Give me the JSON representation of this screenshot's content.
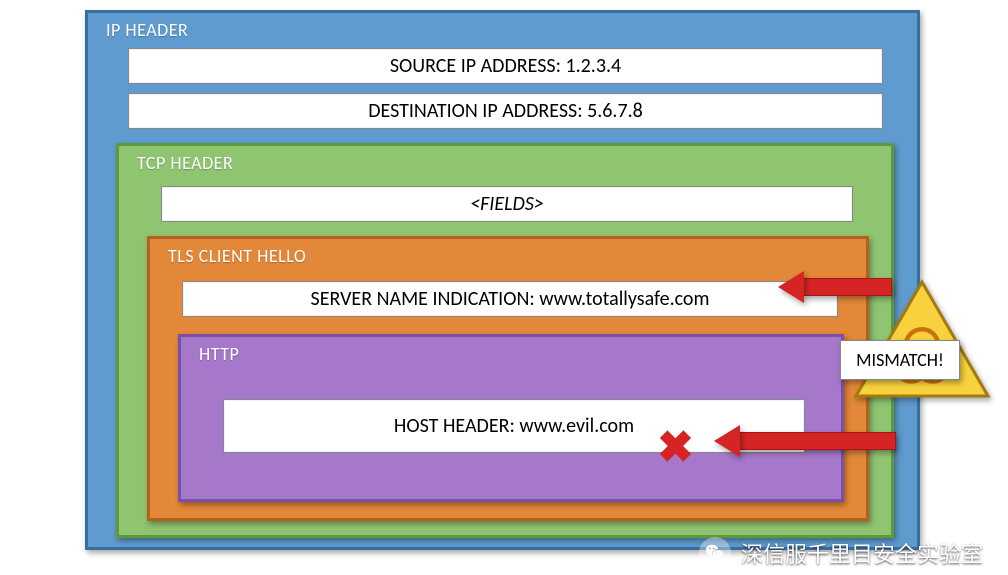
{
  "ip": {
    "title": "IP HEADER",
    "source": "SOURCE IP ADDRESS: 1.2.3.4",
    "destination": "DESTINATION IP ADDRESS: 5.6.7.8"
  },
  "tcp": {
    "title": "TCP HEADER",
    "fields": "<FIELDS>"
  },
  "tls": {
    "title": "TLS CLIENT HELLO",
    "sni": "SERVER NAME INDICATION: www.totallysafe.com"
  },
  "http": {
    "title": "HTTP",
    "host": "HOST HEADER: www.evil.com"
  },
  "mismatch": "MISMATCH!",
  "footer": "深信服千里目安全实验室"
}
